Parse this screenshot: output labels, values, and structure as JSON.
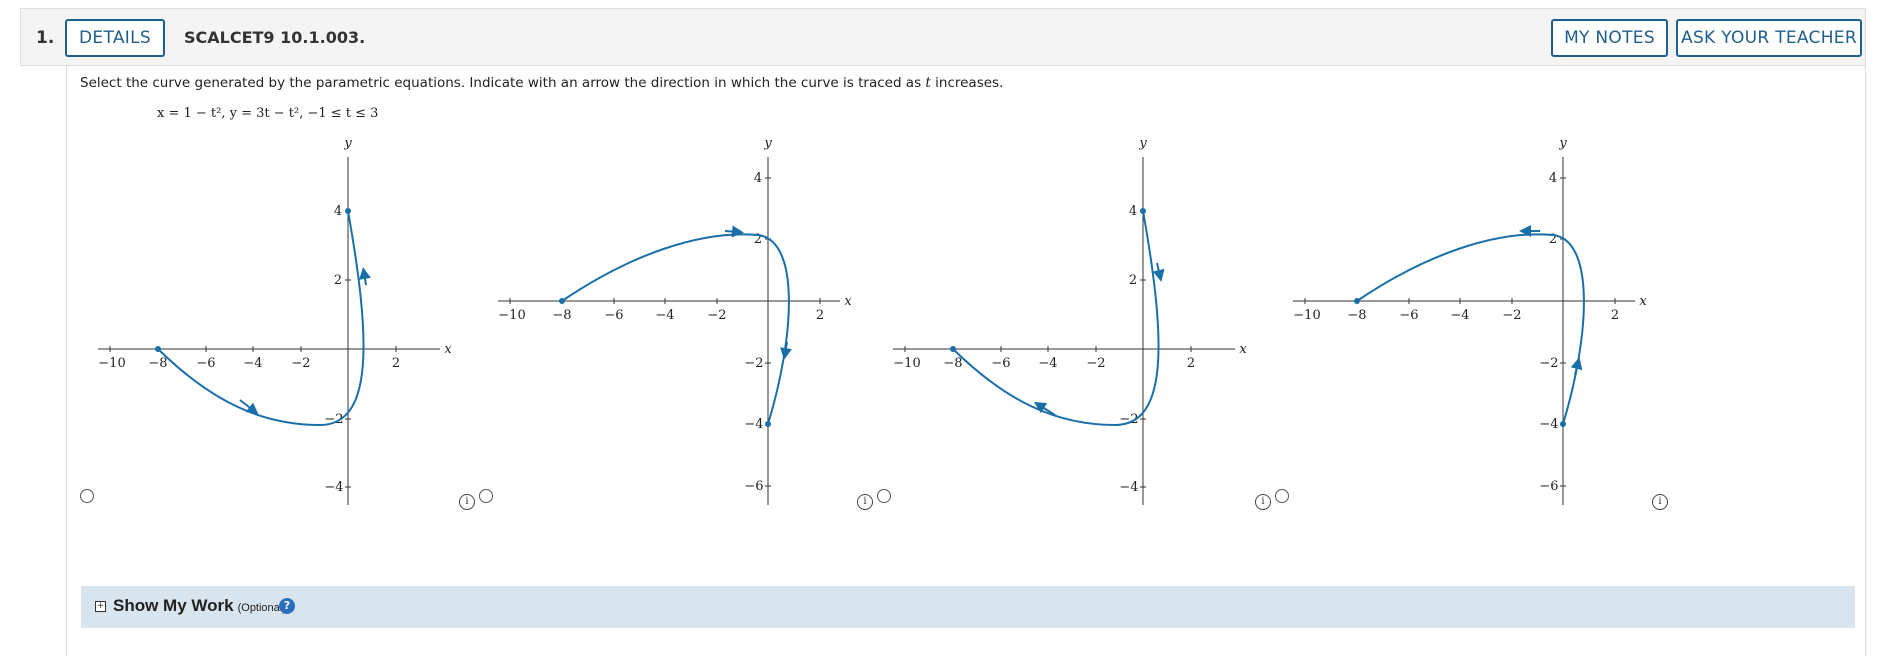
{
  "question": {
    "number": "1.",
    "details_label": "DETAILS",
    "id": "SCALCET9 10.1.003.",
    "my_notes_label": "MY NOTES",
    "ask_teacher_label": "ASK YOUR TEACHER",
    "instructions_before": "Select the curve generated by the parametric equations. Indicate with an arrow the direction in which the curve is traced as ",
    "instructions_var": "t",
    "instructions_after": " increases.",
    "equation": "x = 1 − t², y = 3t − t², −1 ≤ t ≤ 3"
  },
  "choices": [
    {
      "radio": "choice-1",
      "info_icon": "info-icon"
    },
    {
      "radio": "choice-2",
      "info_icon": "info-icon"
    },
    {
      "radio": "choice-3",
      "info_icon": "info-icon"
    },
    {
      "radio": "choice-4",
      "info_icon": "info-icon"
    }
  ],
  "graphs": {
    "x_axis_label": "x",
    "y_axis_label": "y",
    "x_ticks": [
      "−10",
      "−8",
      "−6",
      "−4",
      "−2",
      "2"
    ],
    "curve_color": "#1a6fa8"
  },
  "show_work": {
    "toggle": "+",
    "title": "Show My Work",
    "optional": "(Optional)",
    "help": "?"
  }
}
